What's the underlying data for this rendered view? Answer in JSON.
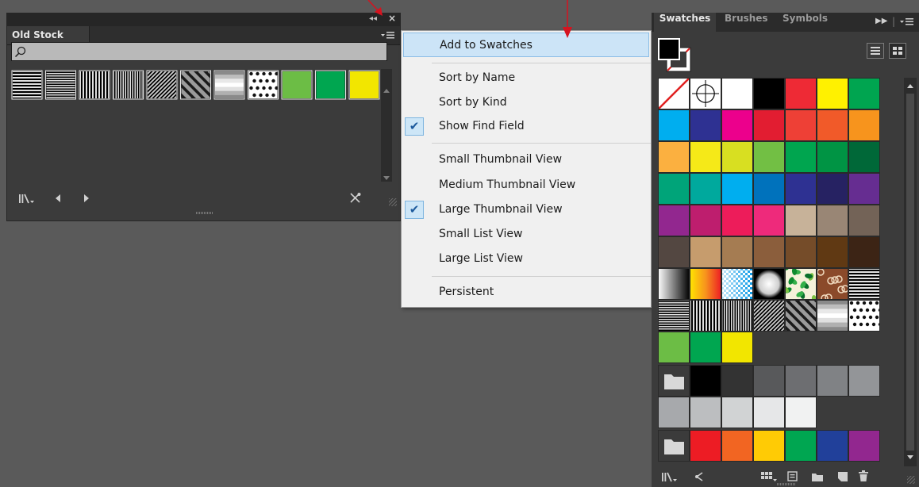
{
  "old_stock": {
    "tab_label": "Old Stock",
    "search_placeholder": "",
    "swatches": [
      {
        "kind": "pattern-horizontal"
      },
      {
        "kind": "pattern-horizontal-fine"
      },
      {
        "kind": "pattern-vertical"
      },
      {
        "kind": "pattern-vertical-fine"
      },
      {
        "kind": "pattern-diagonal"
      },
      {
        "kind": "pattern-diagonal-wide"
      },
      {
        "kind": "pattern-gradient-bands"
      },
      {
        "kind": "pattern-dots"
      },
      {
        "kind": "color",
        "color": "#6cbd45"
      },
      {
        "kind": "color",
        "color": "#00a650"
      },
      {
        "kind": "color",
        "color": "#f2e600"
      }
    ]
  },
  "flyout_menu": {
    "items": [
      {
        "label": "Add to Swatches",
        "highlighted": true
      },
      {
        "label": "Sort by Name"
      },
      {
        "label": "Sort by Kind"
      },
      {
        "label": "Show Find Field",
        "checked": true
      },
      {
        "label": "Small Thumbnail View"
      },
      {
        "label": "Medium Thumbnail View"
      },
      {
        "label": "Large Thumbnail View",
        "checked": true
      },
      {
        "label": "Small List View"
      },
      {
        "label": "Large List View"
      },
      {
        "label": "Persistent"
      }
    ]
  },
  "swatches_panel": {
    "tabs": [
      "Swatches",
      "Brushes",
      "Symbols"
    ],
    "colors": {
      "row1": [
        "none",
        "registration",
        "#ffffff",
        "#000000",
        "#ee2a35",
        "#fff100",
        "#00a550"
      ],
      "row2": [
        "#00aeef",
        "#2e3192",
        "#ec008c",
        "#e21d31",
        "#ee4036",
        "#f15a29",
        "#f7941d"
      ],
      "row3": [
        "#fbb040",
        "#f5e918",
        "#d8df21",
        "#72bf44",
        "#00a54f",
        "#009444",
        "#006838"
      ],
      "row4": [
        "#00a479",
        "#00a99d",
        "#00aeef",
        "#0072bc",
        "#2e3192",
        "#262262",
        "#662d91"
      ],
      "row5": [
        "#92278f",
        "#be1e6e",
        "#ed1c5a",
        "#ee2a7b",
        "#c7b299",
        "#998675",
        "#736357"
      ],
      "row6": [
        "#534741",
        "#c69c6d",
        "#a57c52",
        "#8b5e3c",
        "#754c29",
        "#603913",
        "#3c2415"
      ],
      "row7": [
        "gradient-bw",
        "gradient-fire",
        "pattern-checker-blue",
        "gradient-radial",
        "pattern-foliage",
        "pattern-paisley",
        "pattern-horizontal"
      ],
      "row8": [
        "pattern-horizontal-fine",
        "pattern-vertical",
        "pattern-vertical-fine",
        "pattern-diagonal",
        "pattern-diagonal-wide",
        "pattern-gradient-bands",
        "pattern-dots"
      ],
      "row9": [
        "#6cbd45",
        "#00a650",
        "#f2e600"
      ],
      "row10": [
        "folder",
        "#000000",
        "#333333",
        "#58595b",
        "#6d6e71",
        "#808285",
        "#939598"
      ],
      "row11": [
        "#a7a9ac",
        "#bcbec0",
        "#d1d3d4",
        "#e6e7e8",
        "#f1f2f2"
      ],
      "row12": [
        "folder",
        "#ed1c24",
        "#f26522",
        "#ffcb05",
        "#00a651",
        "#21409a",
        "#92278f"
      ]
    }
  },
  "annotation_color": "#d6131f"
}
